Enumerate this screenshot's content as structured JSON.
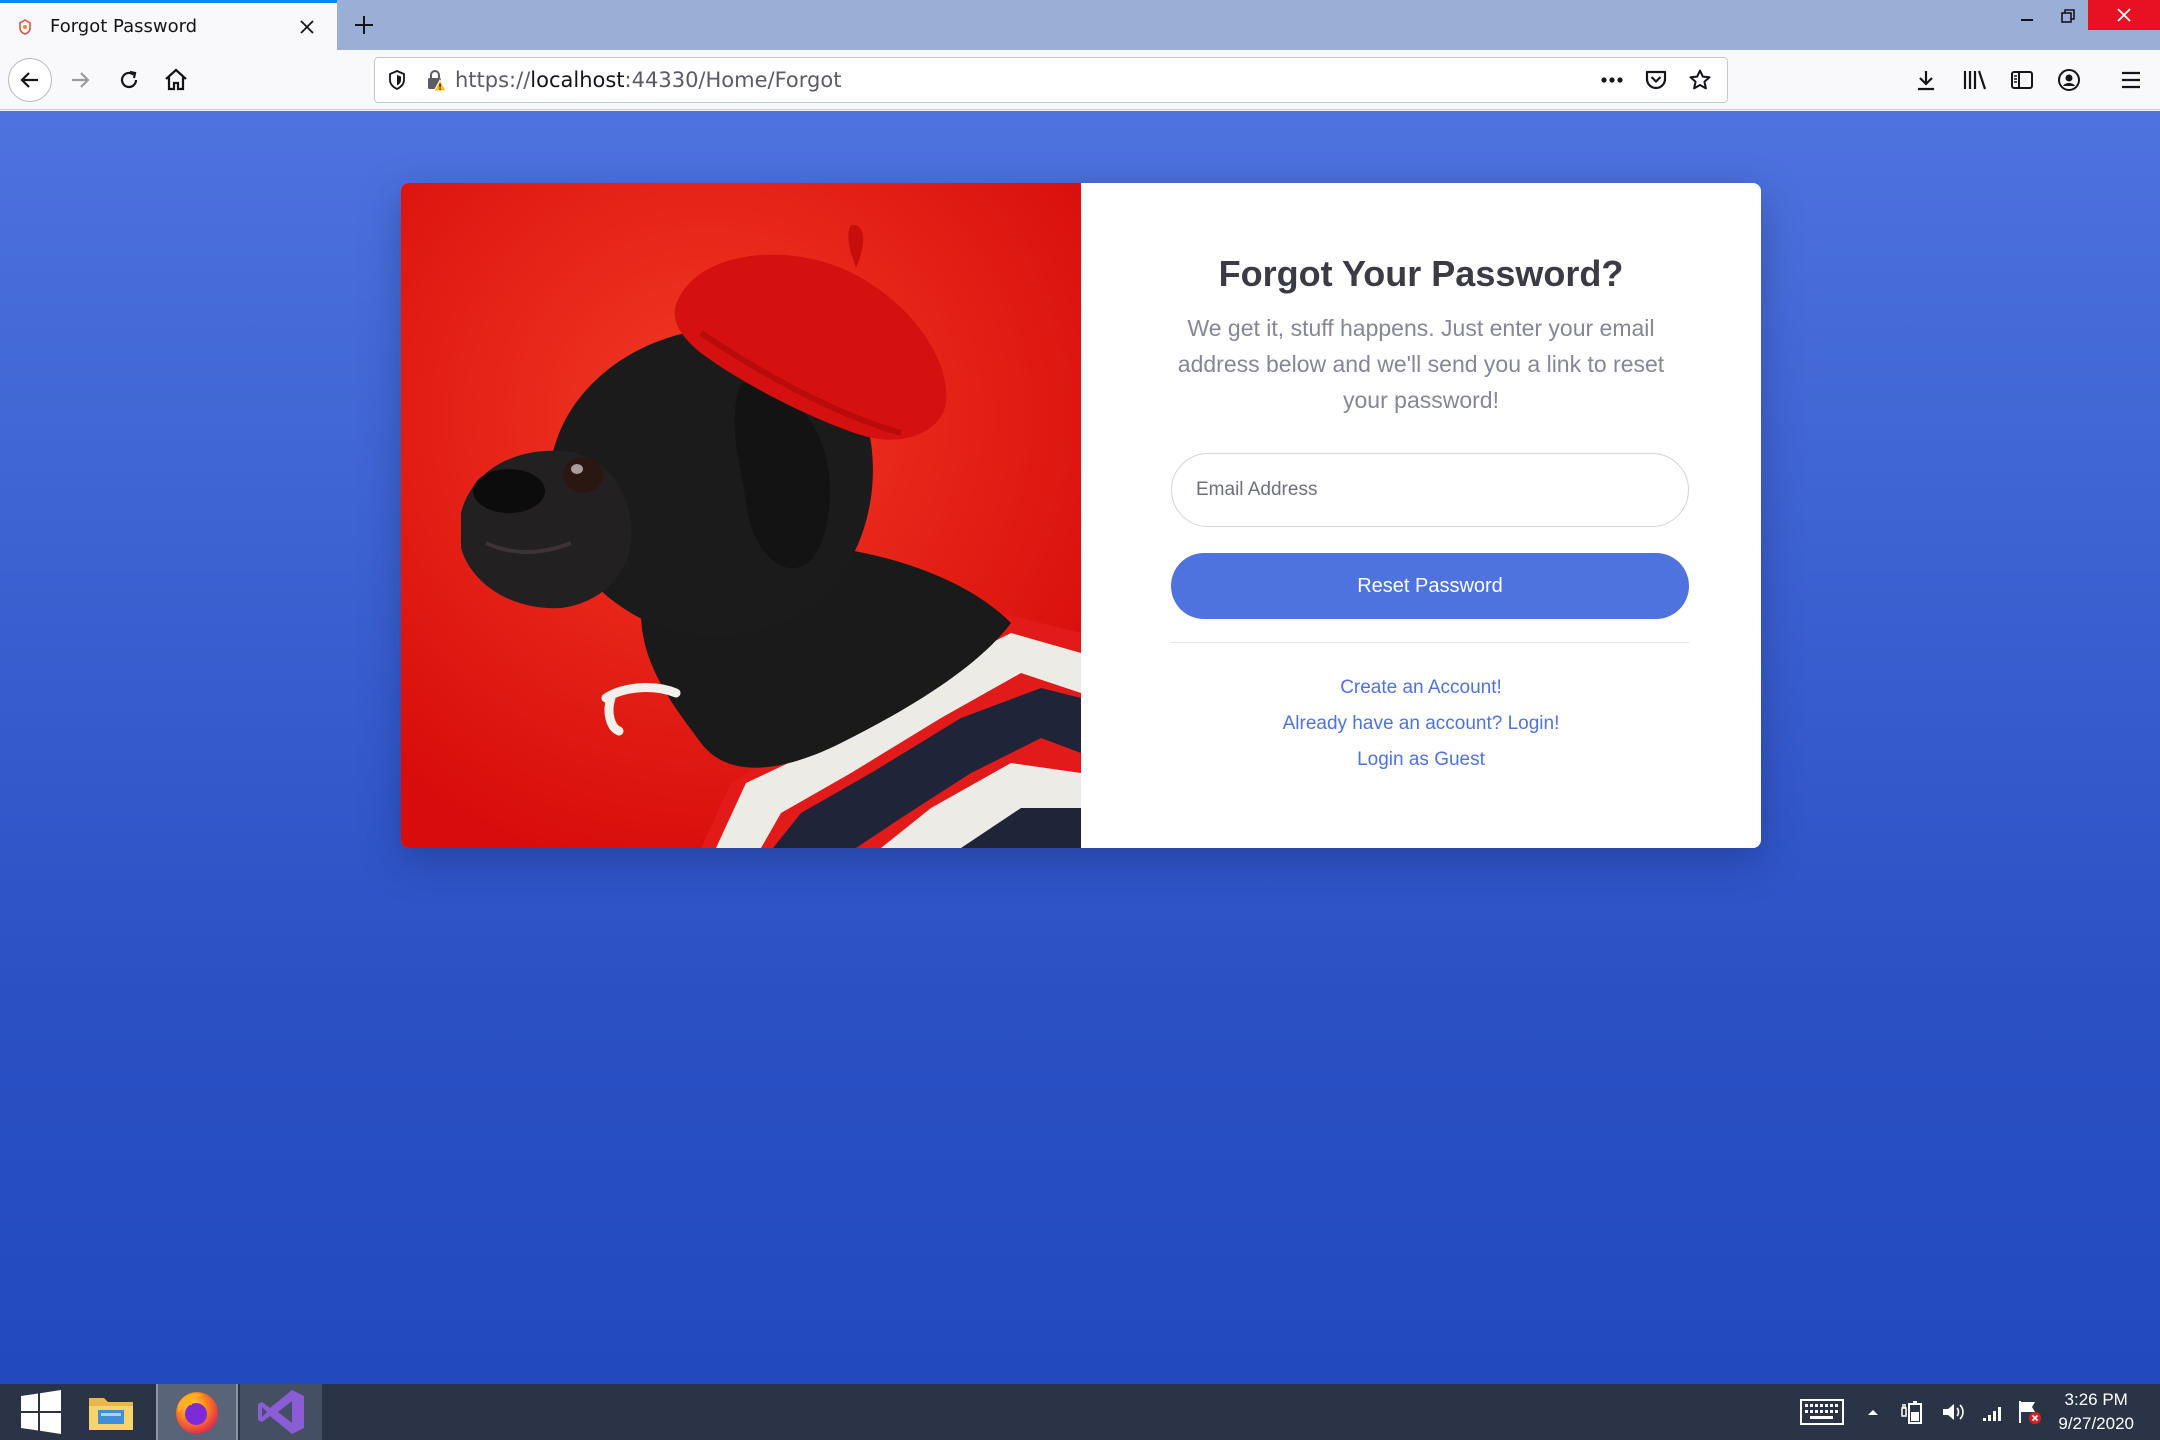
{
  "browser": {
    "tab_title": "Forgot Password",
    "url_scheme": "https://",
    "url_host": "localhost",
    "url_rest": ":44330/Home/Forgot",
    "accent_color": "#0a84ff"
  },
  "page": {
    "title": "Forgot Your Password?",
    "description": "We get it, stuff happens. Just enter your email address below and we'll send you a link to reset your password!",
    "email_placeholder": "Email Address",
    "email_value": "",
    "reset_button": "Reset Password",
    "links": {
      "create_account": "Create an Account!",
      "login": "Already have an account? Login!",
      "guest": "Login as Guest"
    },
    "colors": {
      "primary": "#4e73df",
      "background_top": "#4e73df",
      "background_bottom": "#224abe",
      "image_background": "#e61a16"
    }
  },
  "taskbar": {
    "time": "3:26 PM",
    "date": "9/27/2020",
    "apps": [
      "start-icon",
      "file-explorer-icon",
      "firefox-icon",
      "visual-studio-icon"
    ]
  }
}
